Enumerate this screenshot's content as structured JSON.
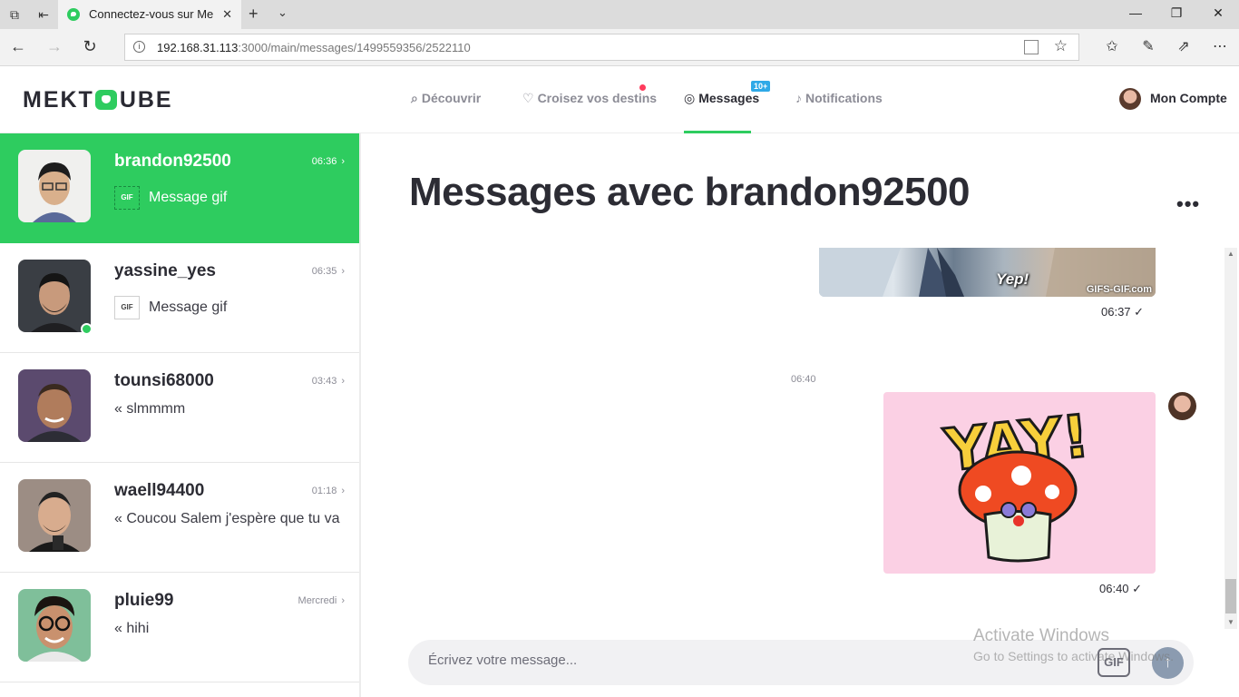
{
  "browser": {
    "tab_title": "Connectez-vous sur Me",
    "url_host": "192.168.31.113",
    "url_path": ":3000/main/messages/1499559356/2522110"
  },
  "header": {
    "logo_left": "MEKT",
    "logo_right": "UBE",
    "nav": [
      {
        "label": "Découvrir",
        "icon": "search-icon"
      },
      {
        "label": "Croisez vos destins",
        "icon": "crossed-hearts-icon"
      },
      {
        "label": "Messages",
        "icon": "chat-icon",
        "active": true,
        "badge": "10+"
      },
      {
        "label": "Notifications",
        "icon": "bell-icon"
      }
    ],
    "account_label": "Mon Compte"
  },
  "sidebar": {
    "conversations": [
      {
        "name": "brandon92500",
        "time": "06:36",
        "preview": "Message gif",
        "gif": true,
        "active": true
      },
      {
        "name": "yassine_yes",
        "time": "06:35",
        "preview": "Message gif",
        "gif": true,
        "online": true
      },
      {
        "name": "tounsi68000",
        "time": "03:43",
        "preview": "« slmmmm"
      },
      {
        "name": "waell94400",
        "time": "01:18",
        "preview": "« Coucou Salem j'espère que tu va"
      },
      {
        "name": "pluie99",
        "time": "Mercredi",
        "preview": "« hihi"
      }
    ]
  },
  "chat": {
    "title": "Messages avec brandon92500",
    "more": "•••",
    "messages": [
      {
        "gif_caption": "Yep!",
        "gif_watermark": "GIFS-GIF.com",
        "time": "06:37 ✓"
      },
      {
        "separator": "06:40"
      },
      {
        "gif_caption": "YAY!",
        "time": "06:40 ✓"
      }
    ],
    "composer_placeholder": "Écrivez votre message...",
    "gif_button": "GIF",
    "send_icon": "↑"
  },
  "watermark": {
    "title": "Activate Windows",
    "subtitle": "Go to Settings to activate Windows."
  },
  "colors": {
    "brand_green": "#2ecc5f",
    "badge_blue": "#2fa9e7",
    "notification_red": "#ff3b5c"
  }
}
